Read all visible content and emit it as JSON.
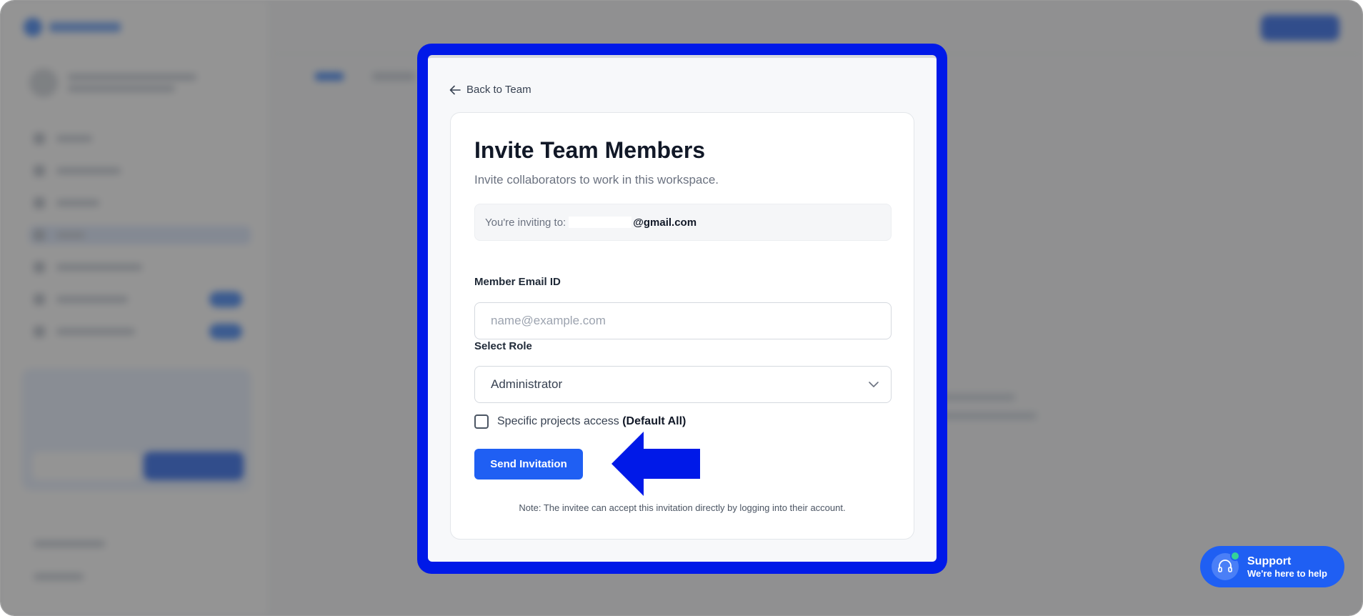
{
  "modal": {
    "back_label": "Back to Team",
    "title": "Invite Team Members",
    "subtitle": "Invite collaborators to work in this workspace.",
    "inviting_label": "You're inviting to:",
    "inviting_email_suffix": "@gmail.com",
    "email_label": "Member Email ID",
    "email_placeholder": "name@example.com",
    "email_value": "",
    "role_label": "Select Role",
    "role_value": "Administrator",
    "project_access_label": "Specific projects access",
    "project_access_default": "(Default All)",
    "project_access_checked": false,
    "send_label": "Send Invitation",
    "note": "Note: The invitee can accept this invitation directly by logging into their account."
  },
  "support": {
    "title": "Support",
    "subtitle": "We're here to help"
  },
  "colors": {
    "highlight": "#0019e8",
    "primary": "#1f5ff3",
    "online": "#34d399"
  },
  "icons": {
    "back": "arrow-left-icon",
    "role_select": "chevron-down-icon",
    "support": "headset-icon",
    "annotation": "arrow-left-annotation"
  }
}
